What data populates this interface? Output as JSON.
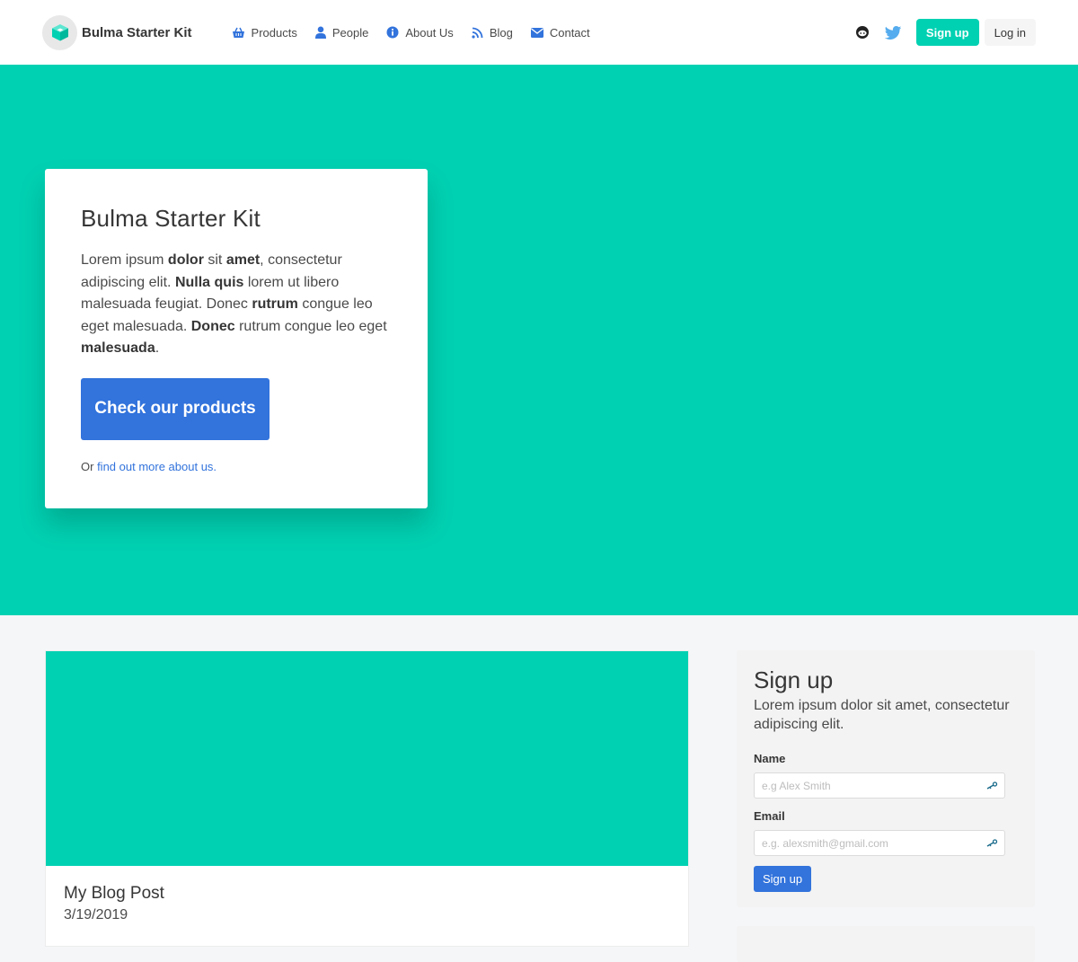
{
  "nav": {
    "brand": "Bulma Starter Kit",
    "links": [
      {
        "label": "Products",
        "icon": "basket-icon"
      },
      {
        "label": "People",
        "icon": "user-icon"
      },
      {
        "label": "About Us",
        "icon": "info-icon"
      },
      {
        "label": "Blog",
        "icon": "rss-icon"
      },
      {
        "label": "Contact",
        "icon": "envelope-icon"
      }
    ],
    "signup": "Sign up",
    "login": "Log in"
  },
  "hero": {
    "title": "Bulma Starter Kit",
    "text": {
      "t1": "Lorem ipsum ",
      "b1": "dolor",
      "t2": " sit ",
      "b2": "amet",
      "t3": ", consectetur adipiscing elit. ",
      "b3": "Nulla quis",
      "t4": " lorem ut libero malesuada feugiat. Donec ",
      "b4": "rutrum",
      "t5": " congue leo eget malesuada. ",
      "b5": "Donec",
      "t6": " rutrum congue leo eget ",
      "b6": "malesuada",
      "t7": "."
    },
    "button": "Check our products",
    "more_prefix": "Or ",
    "more_link": "find out more about us."
  },
  "blog": {
    "title": "My Blog Post",
    "date": "3/19/2019"
  },
  "signup": {
    "title": "Sign up",
    "subtitle": "Lorem ipsum dolor sit amet, consectetur adipiscing elit.",
    "name_label": "Name",
    "name_placeholder": "e.g Alex Smith",
    "email_label": "Email",
    "email_placeholder": "e.g. alexsmith@gmail.com",
    "button": "Sign up"
  },
  "colors": {
    "primary": "#00d1b2",
    "link": "#3273dc",
    "text": "#4a4a4a",
    "dark": "#363636"
  }
}
